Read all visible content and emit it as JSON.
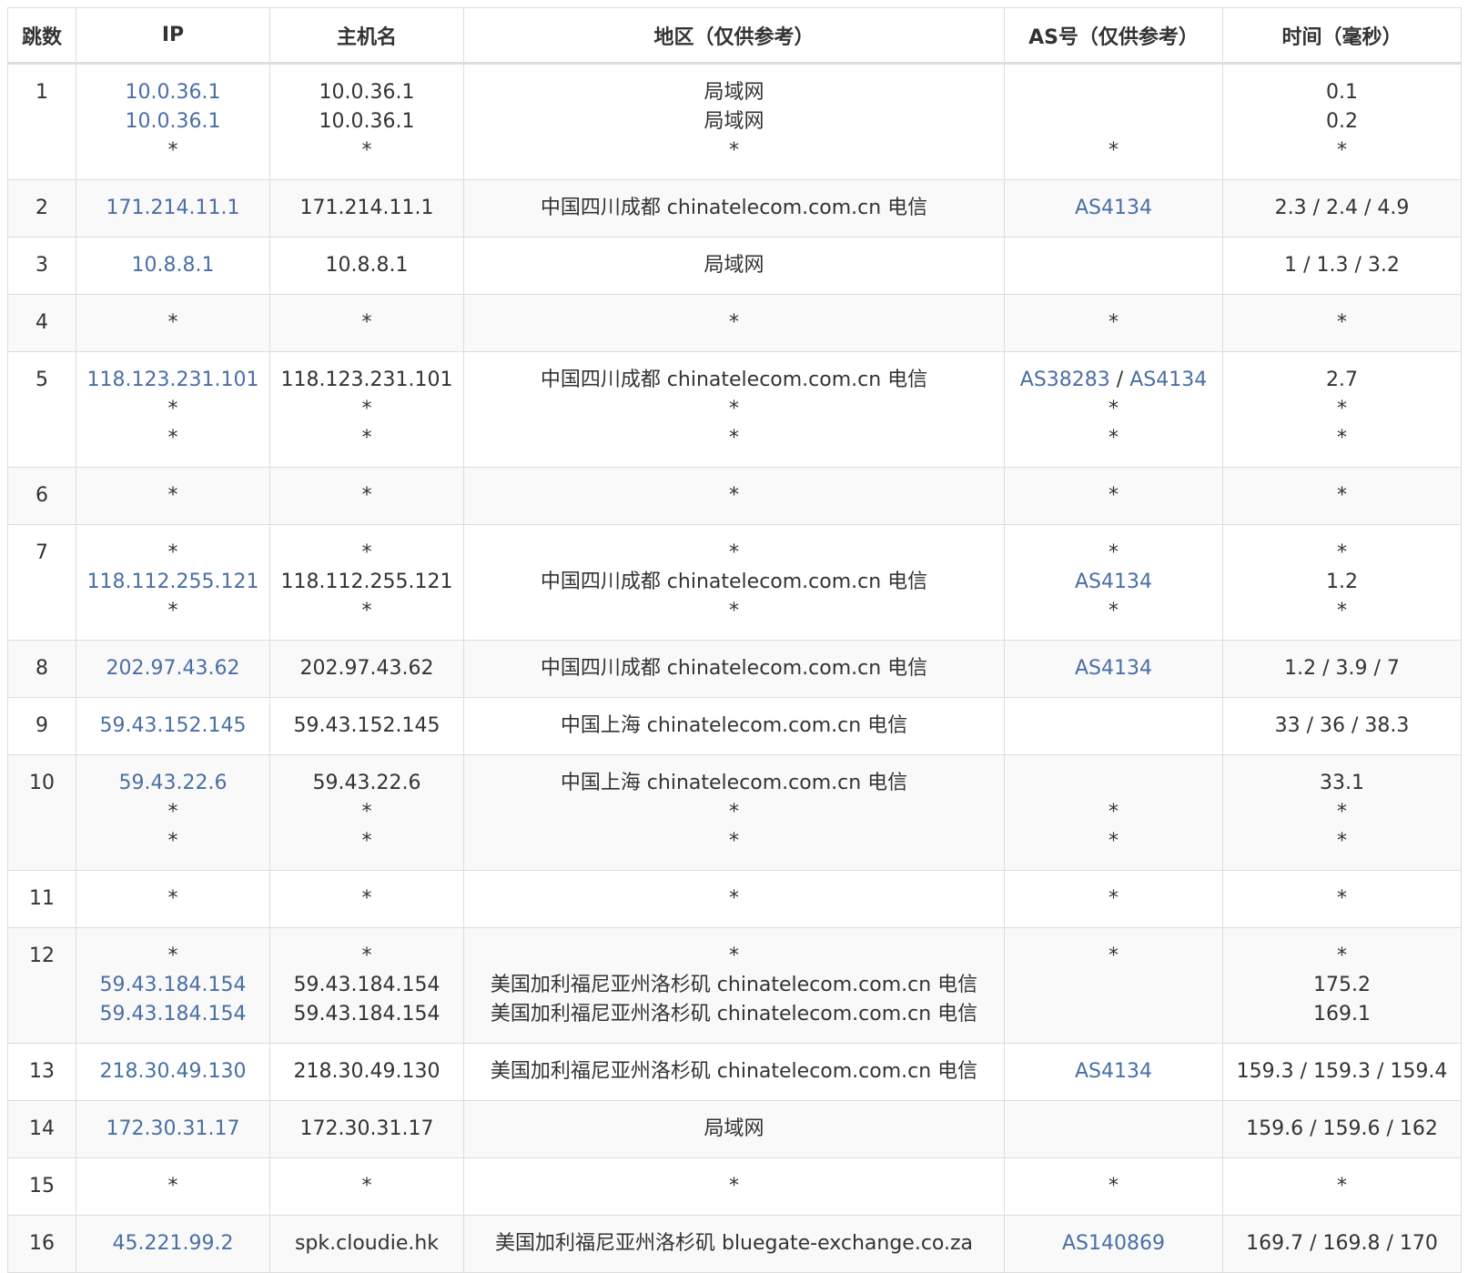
{
  "headers": [
    "跳数",
    "IP",
    "主机名",
    "地区（仅供参考）",
    "AS号（仅供参考）",
    "时间（毫秒）"
  ],
  "rows": [
    {
      "hop": "1",
      "ip": [
        "10.0.36.1",
        "10.0.36.1",
        "*"
      ],
      "host": [
        "10.0.36.1",
        "10.0.36.1",
        "*"
      ],
      "region": [
        "局域网",
        "局域网",
        "*"
      ],
      "as": [
        [],
        [],
        [
          "*"
        ]
      ],
      "time": [
        "0.1",
        "0.2",
        "*"
      ]
    },
    {
      "hop": "2",
      "ip": [
        "171.214.11.1"
      ],
      "host": [
        "171.214.11.1"
      ],
      "region": [
        "中国四川成都 chinatelecom.com.cn 电信"
      ],
      "as": [
        [
          "AS4134"
        ]
      ],
      "time": [
        "2.3 / 2.4 / 4.9"
      ]
    },
    {
      "hop": "3",
      "ip": [
        "10.8.8.1"
      ],
      "host": [
        "10.8.8.1"
      ],
      "region": [
        "局域网"
      ],
      "as": [
        []
      ],
      "time": [
        "1 / 1.3 / 3.2"
      ]
    },
    {
      "hop": "4",
      "ip": [
        "*"
      ],
      "host": [
        "*"
      ],
      "region": [
        "*"
      ],
      "as": [
        [
          "*"
        ]
      ],
      "time": [
        "*"
      ]
    },
    {
      "hop": "5",
      "ip": [
        "118.123.231.101",
        "*",
        "*"
      ],
      "host": [
        "118.123.231.101",
        "*",
        "*"
      ],
      "region": [
        "中国四川成都 chinatelecom.com.cn 电信",
        "*",
        "*"
      ],
      "as": [
        [
          "AS38283",
          "AS4134"
        ],
        [
          "*"
        ],
        [
          "*"
        ]
      ],
      "time": [
        "2.7",
        "*",
        "*"
      ]
    },
    {
      "hop": "6",
      "ip": [
        "*"
      ],
      "host": [
        "*"
      ],
      "region": [
        "*"
      ],
      "as": [
        [
          "*"
        ]
      ],
      "time": [
        "*"
      ]
    },
    {
      "hop": "7",
      "ip": [
        "*",
        "118.112.255.121",
        "*"
      ],
      "host": [
        "*",
        "118.112.255.121",
        "*"
      ],
      "region": [
        "*",
        "中国四川成都 chinatelecom.com.cn 电信",
        "*"
      ],
      "as": [
        [
          "*"
        ],
        [
          "AS4134"
        ],
        [
          "*"
        ]
      ],
      "time": [
        "*",
        "1.2",
        "*"
      ]
    },
    {
      "hop": "8",
      "ip": [
        "202.97.43.62"
      ],
      "host": [
        "202.97.43.62"
      ],
      "region": [
        "中国四川成都 chinatelecom.com.cn 电信"
      ],
      "as": [
        [
          "AS4134"
        ]
      ],
      "time": [
        "1.2 / 3.9 / 7"
      ]
    },
    {
      "hop": "9",
      "ip": [
        "59.43.152.145"
      ],
      "host": [
        "59.43.152.145"
      ],
      "region": [
        "中国上海 chinatelecom.com.cn 电信"
      ],
      "as": [
        []
      ],
      "time": [
        "33 / 36 / 38.3"
      ]
    },
    {
      "hop": "10",
      "ip": [
        "59.43.22.6",
        "*",
        "*"
      ],
      "host": [
        "59.43.22.6",
        "*",
        "*"
      ],
      "region": [
        "中国上海 chinatelecom.com.cn 电信",
        "*",
        "*"
      ],
      "as": [
        [],
        [
          "*"
        ],
        [
          "*"
        ]
      ],
      "time": [
        "33.1",
        "*",
        "*"
      ]
    },
    {
      "hop": "11",
      "ip": [
        "*"
      ],
      "host": [
        "*"
      ],
      "region": [
        "*"
      ],
      "as": [
        [
          "*"
        ]
      ],
      "time": [
        "*"
      ]
    },
    {
      "hop": "12",
      "ip": [
        "*",
        "59.43.184.154",
        "59.43.184.154"
      ],
      "host": [
        "*",
        "59.43.184.154",
        "59.43.184.154"
      ],
      "region": [
        "*",
        "美国加利福尼亚州洛杉矶 chinatelecom.com.cn 电信",
        "美国加利福尼亚州洛杉矶 chinatelecom.com.cn 电信"
      ],
      "as": [
        [
          "*"
        ],
        [],
        []
      ],
      "time": [
        "*",
        "175.2",
        "169.1"
      ]
    },
    {
      "hop": "13",
      "ip": [
        "218.30.49.130"
      ],
      "host": [
        "218.30.49.130"
      ],
      "region": [
        "美国加利福尼亚州洛杉矶 chinatelecom.com.cn 电信"
      ],
      "as": [
        [
          "AS4134"
        ]
      ],
      "time": [
        "159.3 / 159.3 / 159.4"
      ]
    },
    {
      "hop": "14",
      "ip": [
        "172.30.31.17"
      ],
      "host": [
        "172.30.31.17"
      ],
      "region": [
        "局域网"
      ],
      "as": [
        []
      ],
      "time": [
        "159.6 / 159.6 / 162"
      ]
    },
    {
      "hop": "15",
      "ip": [
        "*"
      ],
      "host": [
        "*"
      ],
      "region": [
        "*"
      ],
      "as": [
        [
          "*"
        ]
      ],
      "time": [
        "*"
      ]
    },
    {
      "hop": "16",
      "ip": [
        "45.221.99.2"
      ],
      "host": [
        "spk.cloudie.hk"
      ],
      "region": [
        "美国加利福尼亚州洛杉矶 bluegate-exchange.co.za"
      ],
      "as": [
        [
          "AS140869"
        ]
      ],
      "time": [
        "169.7 / 169.8 / 170"
      ]
    }
  ],
  "colors": {
    "link": "#4a6fa5",
    "text": "#333333",
    "border": "#dddddd",
    "stripe": "#f9f9f9"
  }
}
